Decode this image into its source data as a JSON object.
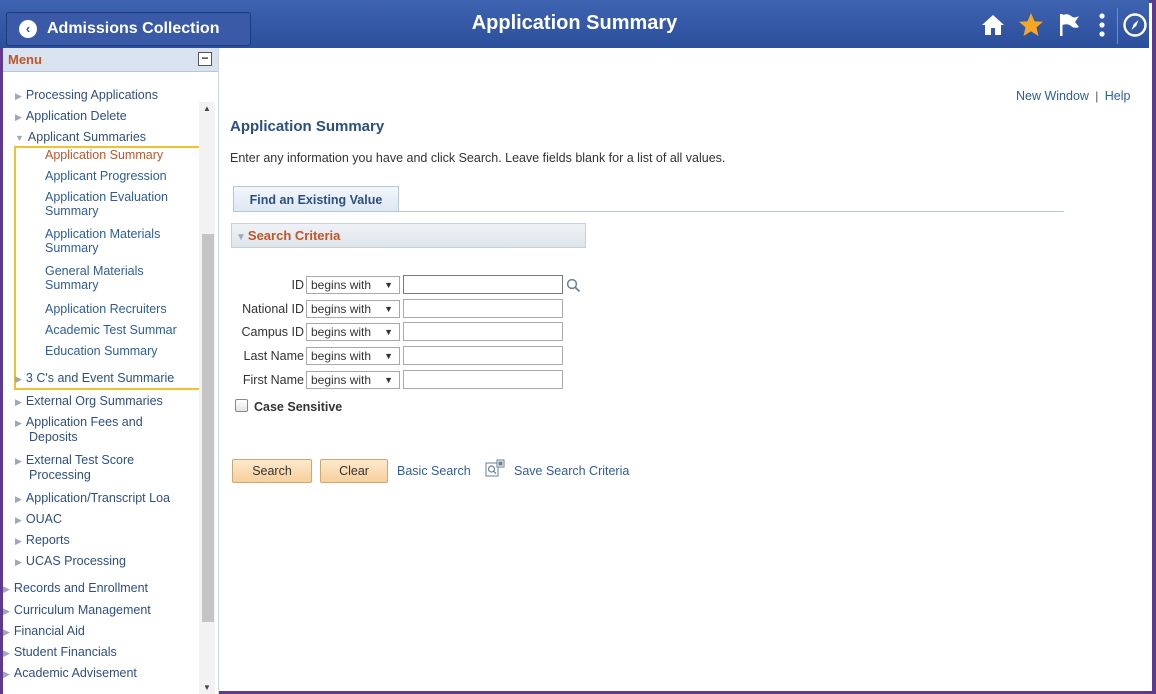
{
  "header": {
    "back_label": "Admissions Collection",
    "title": "Application Summary",
    "icons": [
      "home-icon",
      "favorites-star-icon",
      "notification-flag-icon",
      "actions-menu-icon",
      "navbar-compass-icon"
    ],
    "colors": {
      "bar": "#2c4f9c",
      "star": "#f5a623",
      "accent": "#c0562a",
      "frame": "#5d3a8e",
      "highlight": "#f2c12e"
    }
  },
  "sidebar": {
    "menu_label": "Menu",
    "items": [
      {
        "label": "Processing Applications",
        "state": "collapsed"
      },
      {
        "label": "Application Delete",
        "state": "collapsed"
      },
      {
        "label": "Applicant Summaries",
        "state": "expanded"
      },
      {
        "label": "Application Summary",
        "state": "active"
      },
      {
        "label": "Applicant Progression"
      },
      {
        "label": "Application Evaluation Summary"
      },
      {
        "label": "Application Materials Summary"
      },
      {
        "label": "General Materials Summary"
      },
      {
        "label": "Application Recruiters"
      },
      {
        "label": "Academic Test Summar"
      },
      {
        "label": "Education Summary"
      },
      {
        "label": "3 C's and Event Summarie",
        "state": "collapsed"
      },
      {
        "label": "External Org Summaries",
        "state": "collapsed"
      },
      {
        "label": "Application Fees and Deposits",
        "state": "collapsed"
      },
      {
        "label": "External Test Score Processing",
        "state": "collapsed"
      },
      {
        "label": "Application/Transcript Loa",
        "state": "collapsed"
      },
      {
        "label": "OUAC",
        "state": "collapsed"
      },
      {
        "label": "Reports",
        "state": "collapsed"
      },
      {
        "label": "UCAS Processing",
        "state": "collapsed"
      },
      {
        "label": "Records and Enrollment",
        "state": "collapsed"
      },
      {
        "label": "Curriculum Management",
        "state": "collapsed"
      },
      {
        "label": "Financial Aid",
        "state": "collapsed"
      },
      {
        "label": "Student Financials",
        "state": "collapsed"
      },
      {
        "label": "Academic Advisement",
        "state": "collapsed"
      }
    ]
  },
  "main": {
    "new_window": "New Window",
    "separator": "|",
    "help": "Help",
    "page_title": "Application Summary",
    "instructions": "Enter any information you have and click Search. Leave fields blank for a list of all values.",
    "tab_label": "Find an Existing Value",
    "criteria_label": "Search Criteria",
    "fields": [
      {
        "label": "ID",
        "operator": "begins with",
        "value": ""
      },
      {
        "label": "National ID",
        "operator": "begins with",
        "value": ""
      },
      {
        "label": "Campus ID",
        "operator": "begins with",
        "value": ""
      },
      {
        "label": "Last Name",
        "operator": "begins with",
        "value": ""
      },
      {
        "label": "First Name",
        "operator": "begins with",
        "value": ""
      }
    ],
    "case_sensitive_label": "Case Sensitive",
    "case_sensitive_checked": false,
    "search_button": "Search",
    "clear_button": "Clear",
    "basic_search": "Basic Search",
    "save_search": "Save Search Criteria"
  }
}
